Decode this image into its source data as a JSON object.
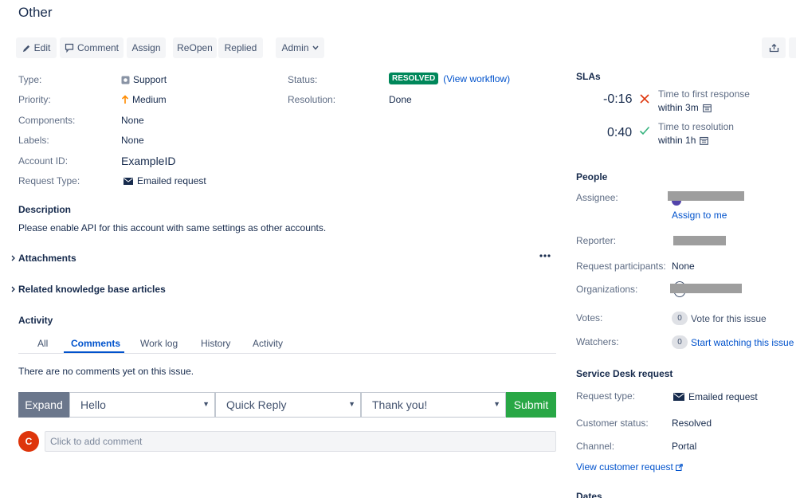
{
  "issue": {
    "title": "Other"
  },
  "toolbar": {
    "edit": "Edit",
    "comment": "Comment",
    "assign": "Assign",
    "reopen": "ReOpen",
    "replied": "Replied",
    "admin": "Admin"
  },
  "details": {
    "type_label": "Type:",
    "type_value": "Support",
    "priority_label": "Priority:",
    "priority_value": "Medium",
    "components_label": "Components:",
    "components_value": "None",
    "labels_label": "Labels:",
    "labels_value": "None",
    "account_label": "Account ID:",
    "account_value": "ExampleID",
    "request_type_label": "Request Type:",
    "request_type_value": "Emailed request",
    "status_label": "Status:",
    "status_value": "RESOLVED",
    "view_workflow": "(View workflow)",
    "resolution_label": "Resolution:",
    "resolution_value": "Done"
  },
  "description": {
    "heading": "Description",
    "text": "Please enable API for this account with same settings as other accounts."
  },
  "attachments": {
    "heading": "Attachments"
  },
  "knowledge": {
    "heading": "Related knowledge base articles"
  },
  "activity": {
    "heading": "Activity",
    "tabs": [
      "All",
      "Comments",
      "Work log",
      "History",
      "Activity"
    ],
    "empty": "There are no comments yet on this issue.",
    "expand": "Expand",
    "select1": "Hello",
    "select2": "Quick Reply",
    "select3": "Thank you!",
    "submit": "Submit",
    "avatar_letter": "C",
    "comment_placeholder": "Click to add comment"
  },
  "slas": {
    "heading": "SLAs",
    "items": [
      {
        "time": "-0:16",
        "name": "Time to first response",
        "target": "within 3m"
      },
      {
        "time": "0:40",
        "name": "Time to resolution",
        "target": "within 1h"
      }
    ]
  },
  "people": {
    "heading": "People",
    "assignee_label": "Assignee:",
    "assign_to_me": "Assign to me",
    "reporter_label": "Reporter:",
    "participants_label": "Request participants:",
    "participants_value": "None",
    "organizations_label": "Organizations:",
    "votes_label": "Votes:",
    "votes_count": "0",
    "votes_action": "Vote for this issue",
    "watchers_label": "Watchers:",
    "watchers_count": "0",
    "watchers_action": "Start watching this issue"
  },
  "service_desk": {
    "heading": "Service Desk request",
    "request_type_label": "Request type:",
    "request_type_value": "Emailed request",
    "customer_status_label": "Customer status:",
    "customer_status_value": "Resolved",
    "channel_label": "Channel:",
    "channel_value": "Portal",
    "view_customer_request": "View customer request"
  },
  "dates": {
    "heading": "Dates"
  },
  "colors": {
    "resolved": "#00875a",
    "submit": "#28a745",
    "link": "#0052cc",
    "avatar": "#de350b",
    "x_mark": "#de350b",
    "check_mark": "#36b37e"
  }
}
